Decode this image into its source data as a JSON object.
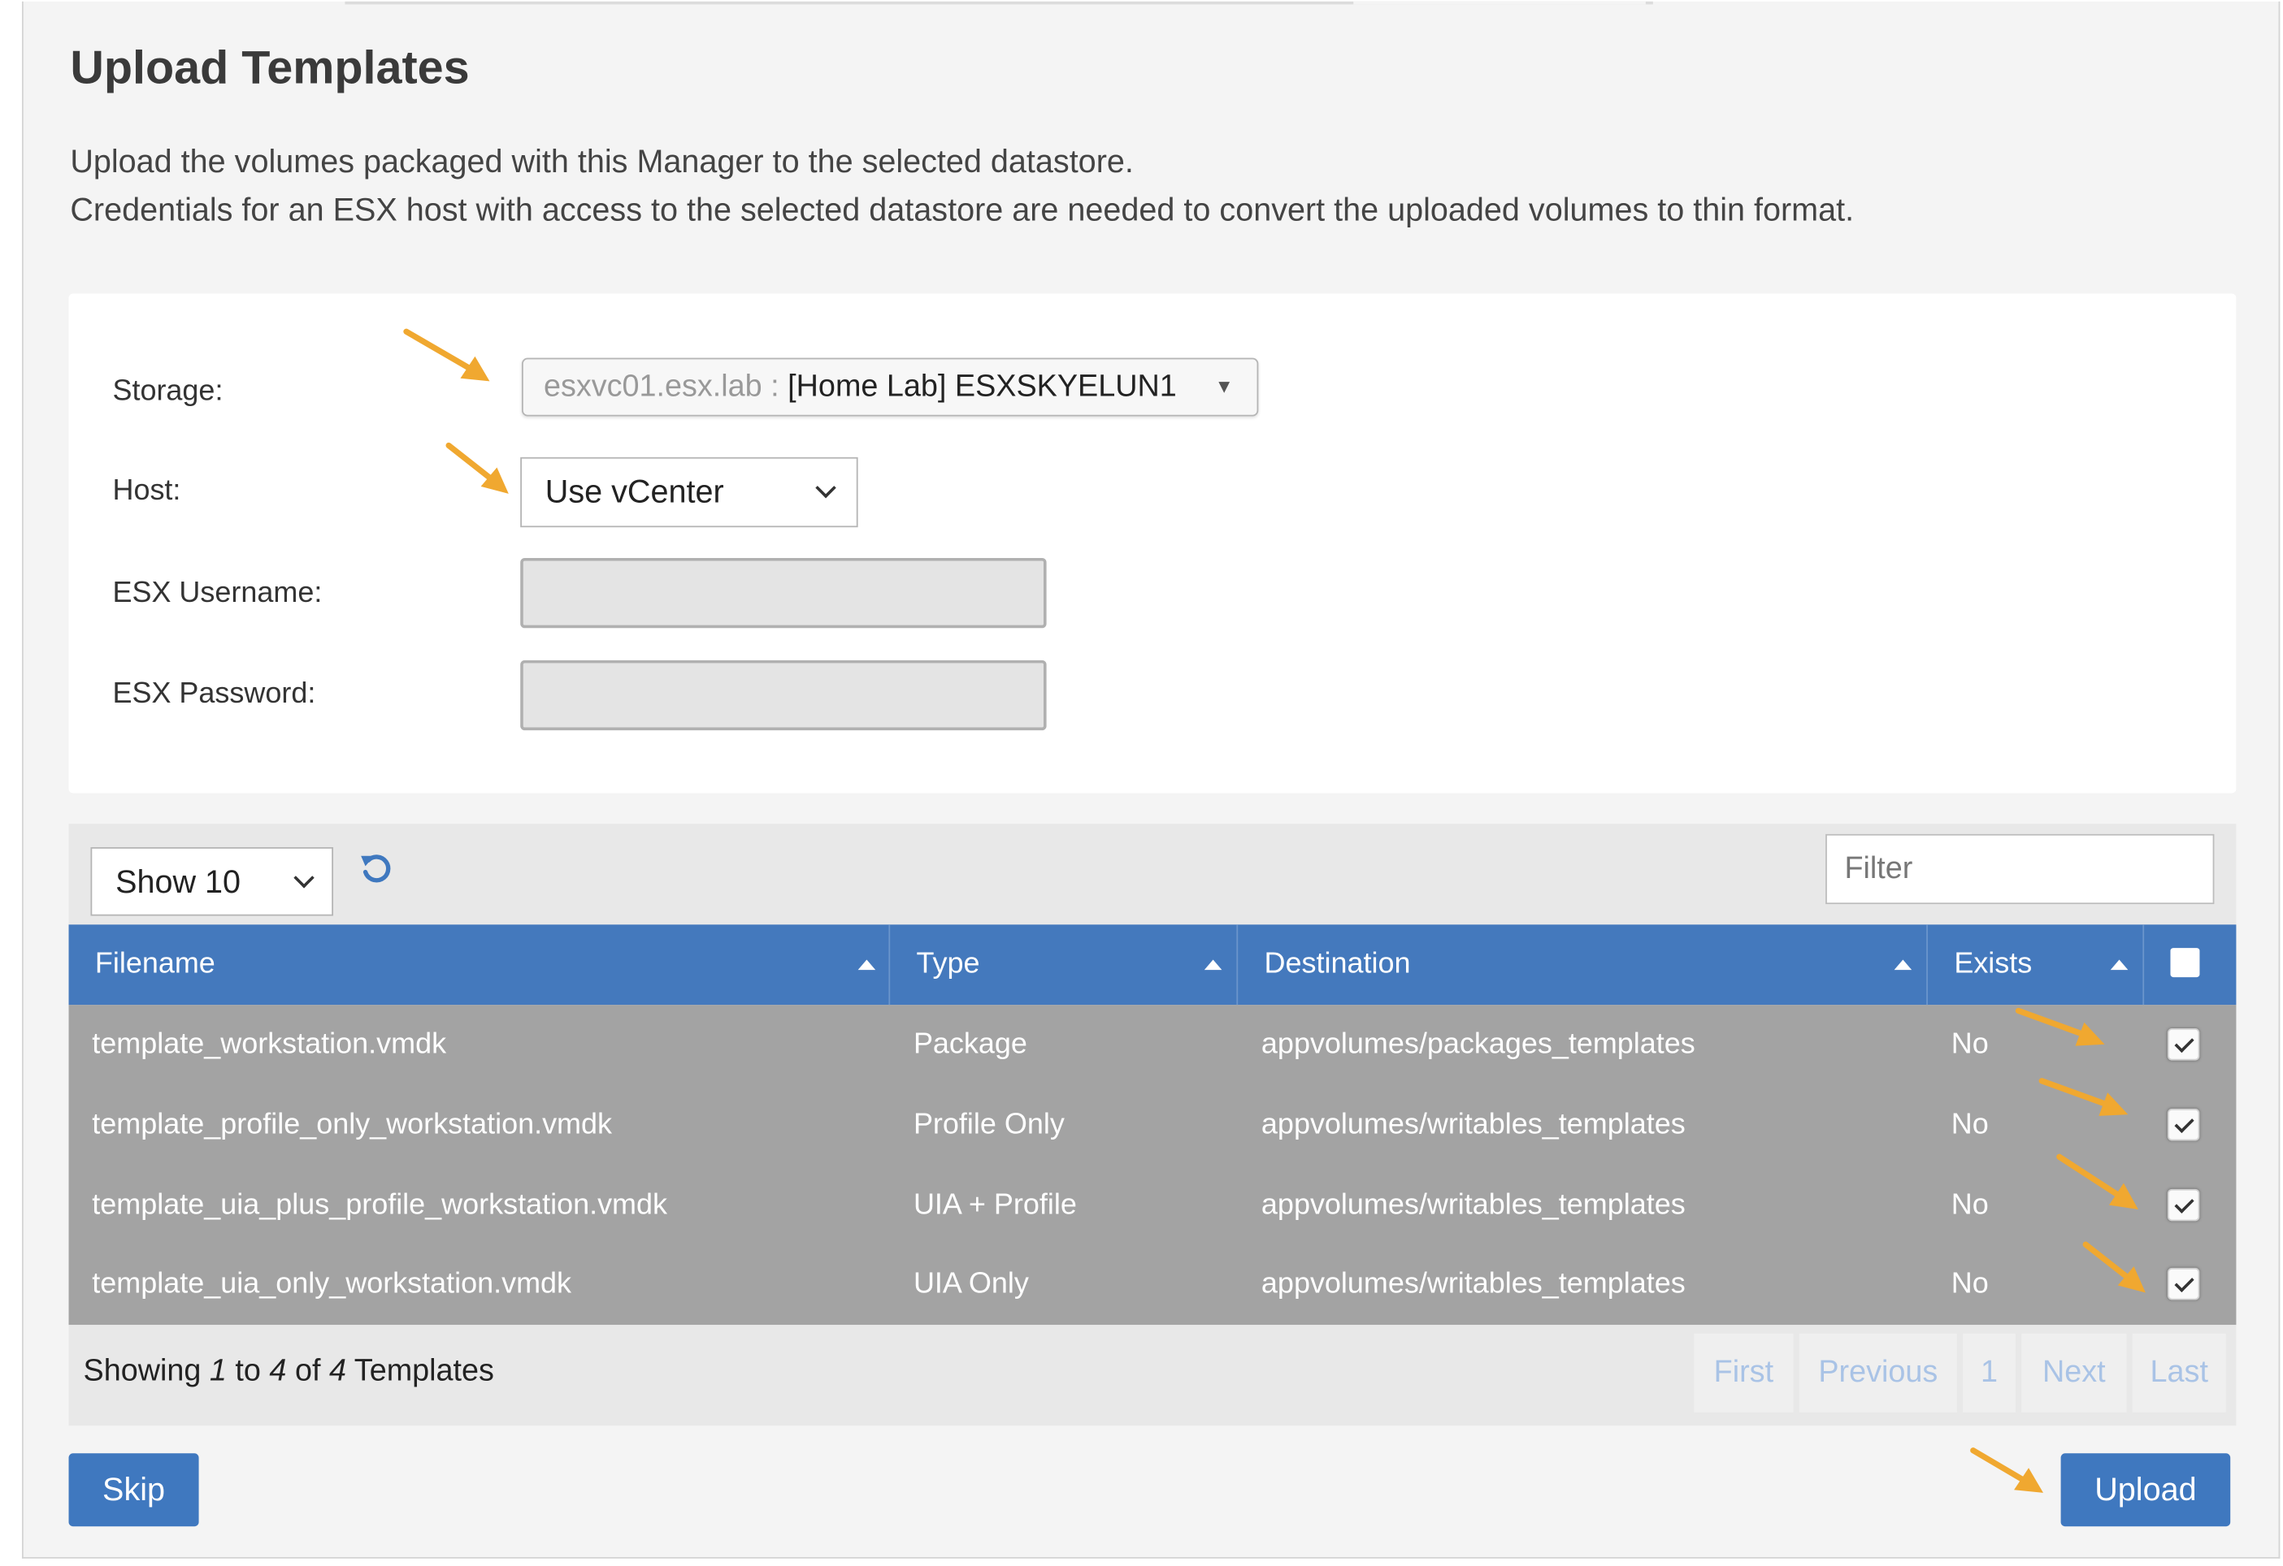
{
  "header": {
    "title": "Upload Templates",
    "desc_line1": "Upload the volumes packaged with this Manager to the selected datastore.",
    "desc_line2": "Credentials for an ESX host with access to the selected datastore are needed to convert the uploaded volumes to thin format."
  },
  "form": {
    "storage_label": "Storage:",
    "storage_server": "esxvc01.esx.lab :",
    "storage_value": "[Home Lab] ESXSKYELUN1",
    "host_label": "Host:",
    "host_value": "Use vCenter",
    "username_label": "ESX Username:",
    "password_label": "ESX Password:"
  },
  "table": {
    "show_value": "Show 10",
    "filter_placeholder": "Filter",
    "columns": [
      "Filename",
      "Type",
      "Destination",
      "Exists"
    ],
    "rows": [
      {
        "filename": "template_workstation.vmdk",
        "type": "Package",
        "destination": "appvolumes/packages_templates",
        "exists": "No",
        "checked": true
      },
      {
        "filename": "template_profile_only_workstation.vmdk",
        "type": "Profile Only",
        "destination": "appvolumes/writables_templates",
        "exists": "No",
        "checked": true
      },
      {
        "filename": "template_uia_plus_profile_workstation.vmdk",
        "type": "UIA + Profile",
        "destination": "appvolumes/writables_templates",
        "exists": "No",
        "checked": true
      },
      {
        "filename": "template_uia_only_workstation.vmdk",
        "type": "UIA Only",
        "destination": "appvolumes/writables_templates",
        "exists": "No",
        "checked": true
      }
    ],
    "footer": {
      "prefix": "Showing",
      "from": "1",
      "to_word": "to",
      "to": "4",
      "of_word": "of",
      "total": "4",
      "suffix": "Templates"
    },
    "pagination": {
      "first": "First",
      "previous": "Previous",
      "page": "1",
      "next": "Next",
      "last": "Last"
    }
  },
  "actions": {
    "skip": "Skip",
    "upload": "Upload"
  },
  "colors": {
    "accent": "#4479bd",
    "arrow": "#f0a830",
    "row_bg": "#a3a3a3",
    "pager_text": "#a9c3e6"
  }
}
